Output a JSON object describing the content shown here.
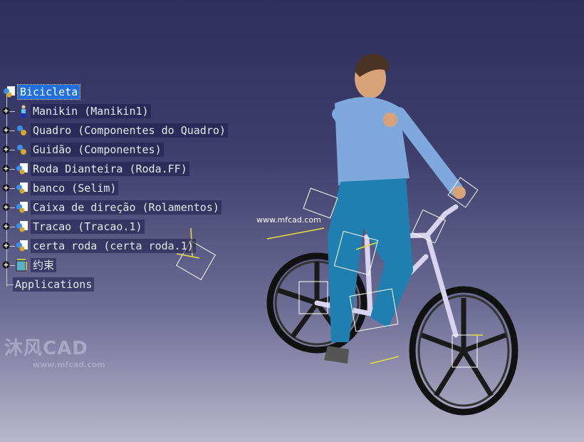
{
  "tree": {
    "root": "Bicicleta",
    "items": [
      {
        "label": "Manikin (Manikin1)",
        "icon": "manikin-icon"
      },
      {
        "label": "Quadro (Componentes do Quadro)",
        "icon": "gears-icon"
      },
      {
        "label": "Guidão (Componentes)",
        "icon": "gears-icon"
      },
      {
        "label": "Roda Dianteira (Roda.FF)",
        "icon": "product-icon"
      },
      {
        "label": "banco (Selim)",
        "icon": "product-icon"
      },
      {
        "label": "Caixa de direção (Rolamentos)",
        "icon": "product-icon"
      },
      {
        "label": "Tracao (Tracao.1)",
        "icon": "product-icon"
      },
      {
        "label": "certa roda (certa roda.1)",
        "icon": "product-icon"
      },
      {
        "label": "约束",
        "icon": "constraints-icon"
      }
    ],
    "applications": "Applications"
  },
  "watermark": {
    "brand": "沐风CAD",
    "url": "www.mfcad.com",
    "overlay_url": "www.mfcad.com"
  },
  "colors": {
    "selection": "#1f6fe0",
    "background_top": "#2f2f5e",
    "background_bottom": "#b9b7cc"
  }
}
